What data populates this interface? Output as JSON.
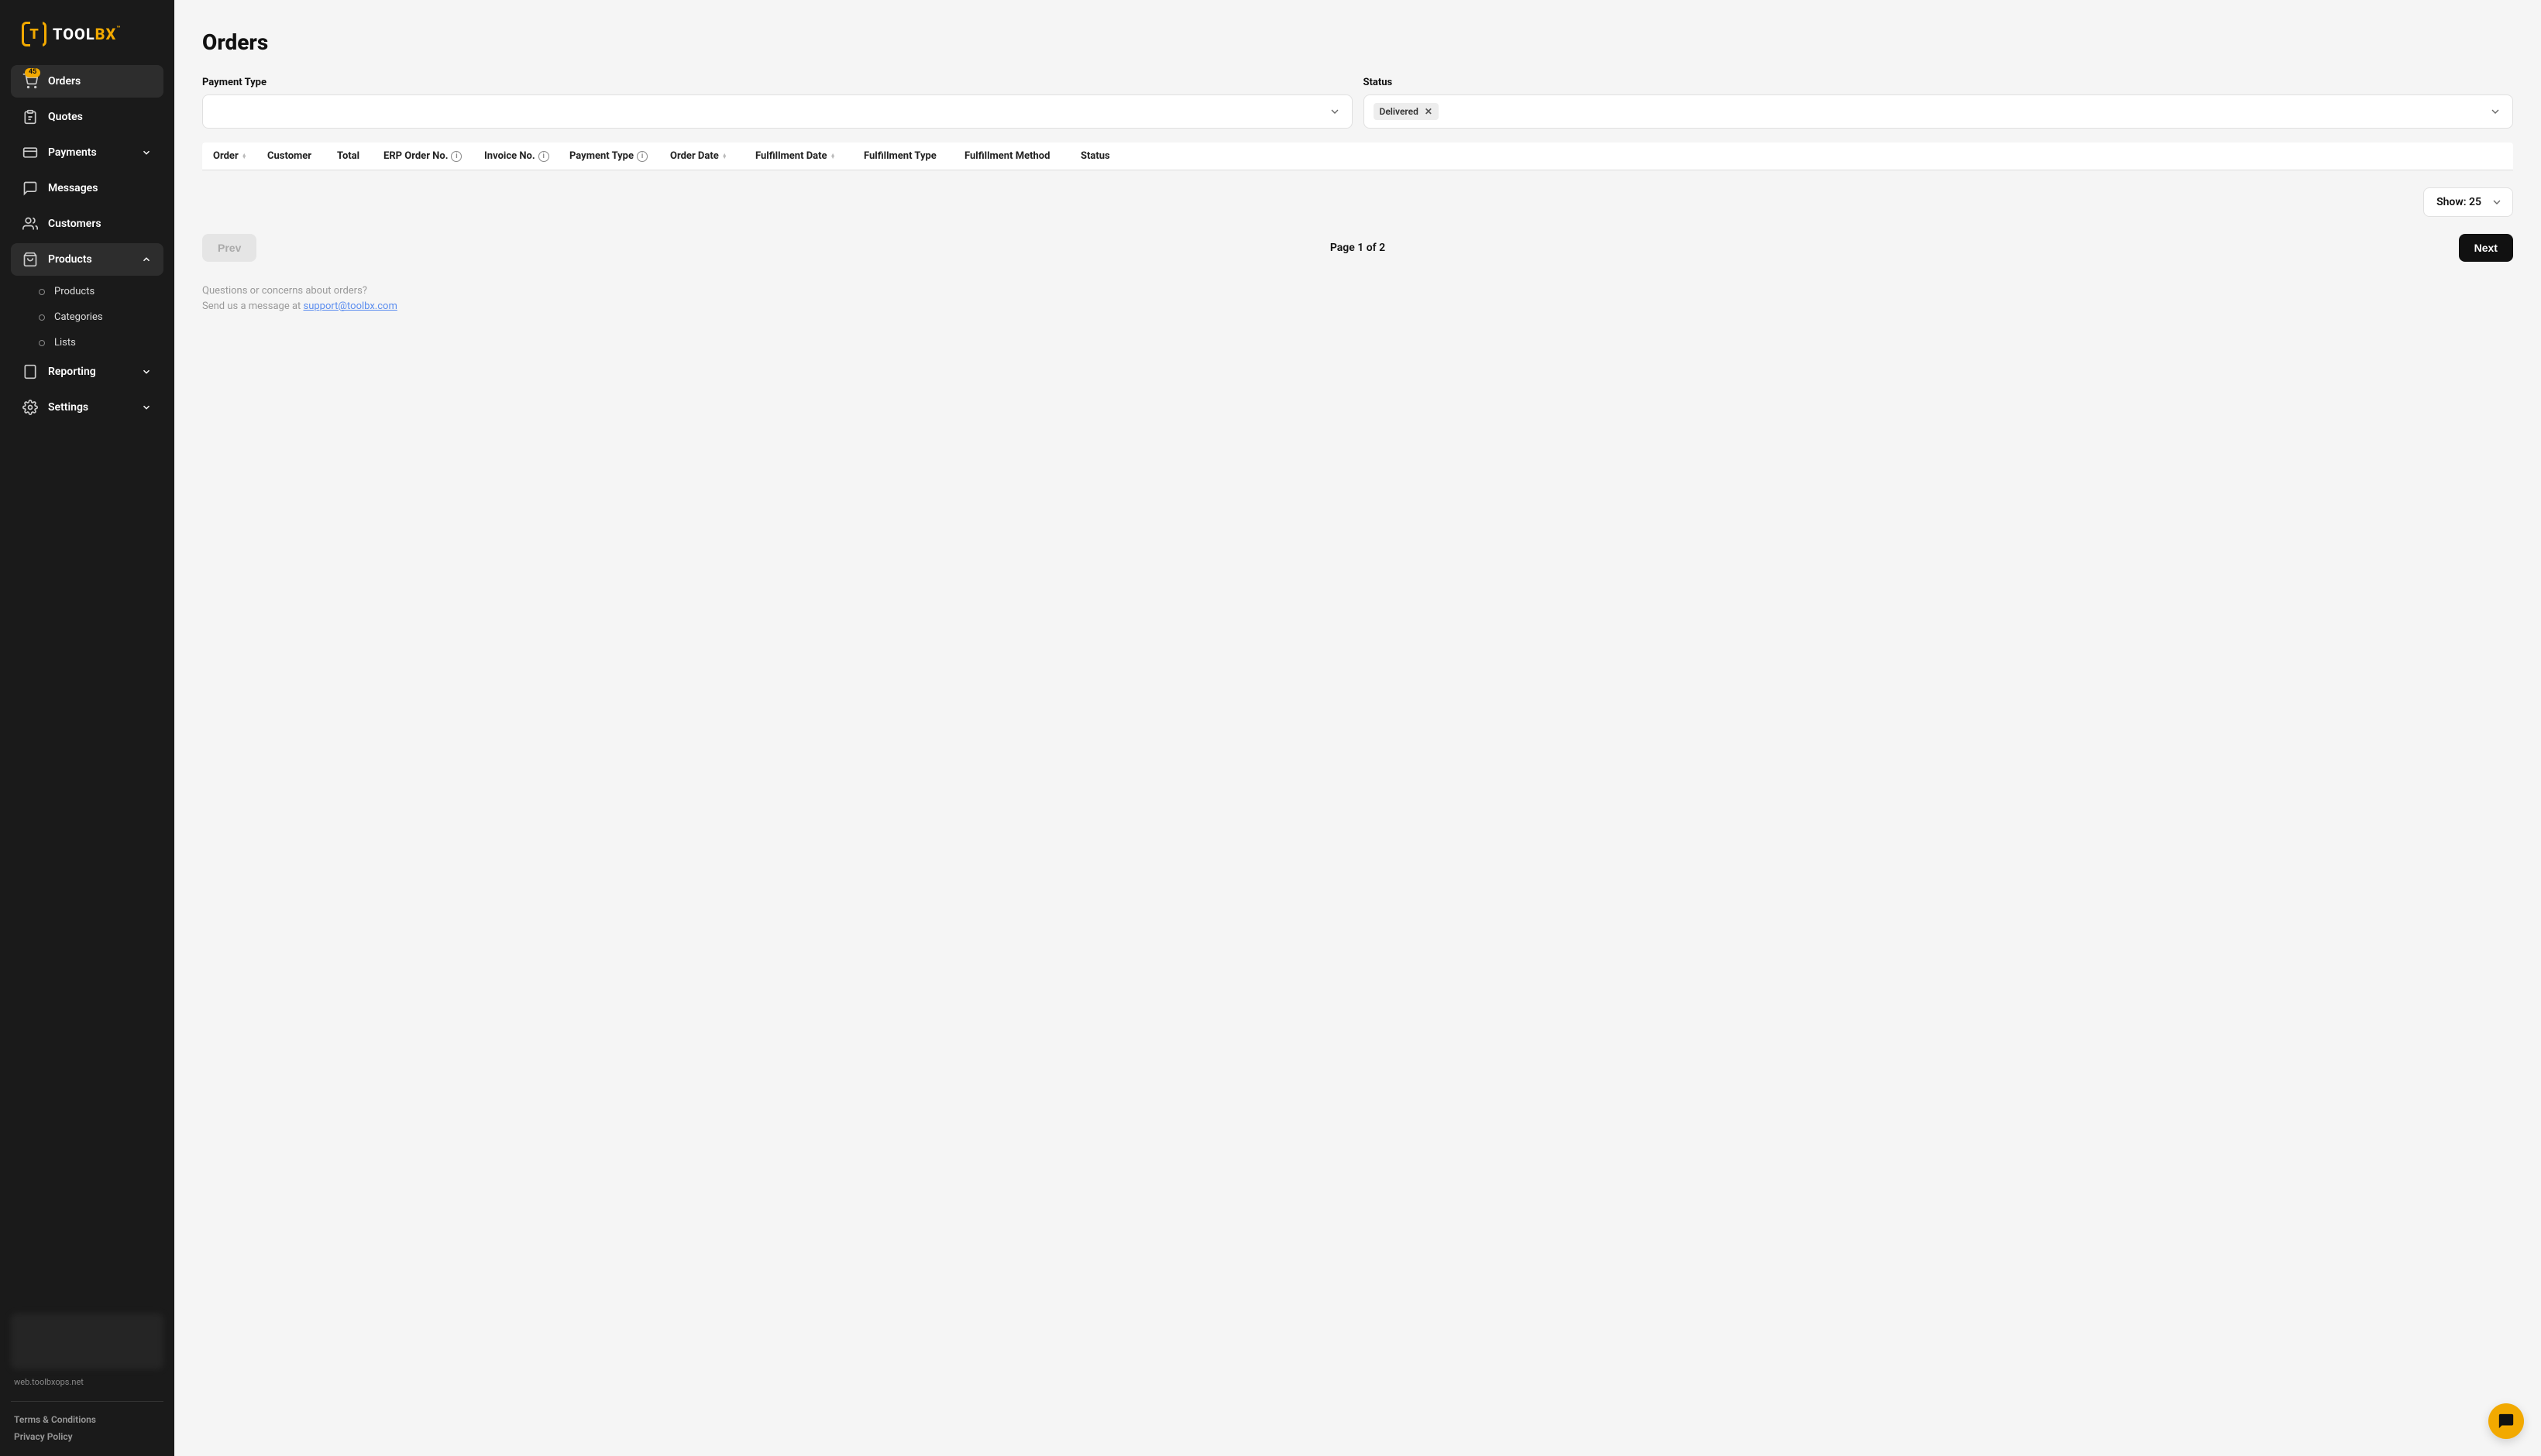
{
  "brand": {
    "name_a": "TOOL",
    "name_b": "BX"
  },
  "sidebar": {
    "items": [
      {
        "label": "Orders",
        "icon": "cart-icon",
        "badge": "45",
        "active": true
      },
      {
        "label": "Quotes",
        "icon": "clipboard-icon"
      },
      {
        "label": "Payments",
        "icon": "card-icon",
        "expandable": true,
        "expanded": false
      },
      {
        "label": "Messages",
        "icon": "chat-icon"
      },
      {
        "label": "Customers",
        "icon": "users-icon"
      },
      {
        "label": "Products",
        "icon": "bag-icon",
        "expandable": true,
        "expanded": true,
        "children": [
          {
            "label": "Products"
          },
          {
            "label": "Categories"
          },
          {
            "label": "Lists"
          }
        ]
      },
      {
        "label": "Reporting",
        "icon": "tablet-icon",
        "expandable": true,
        "expanded": false
      },
      {
        "label": "Settings",
        "icon": "gear-icon",
        "expandable": true,
        "expanded": false
      }
    ],
    "footer_url": "web.toolbxops.net",
    "terms": "Terms & Conditions",
    "privacy": "Privacy Policy"
  },
  "page": {
    "title": "Orders",
    "filters": {
      "payment_type": {
        "label": "Payment Type",
        "value": ""
      },
      "status": {
        "label": "Status",
        "chips": [
          "Delivered"
        ]
      }
    },
    "columns": [
      {
        "label": "Order",
        "sortable": true
      },
      {
        "label": "Customer"
      },
      {
        "label": "Total"
      },
      {
        "label": "ERP Order No.",
        "info": true
      },
      {
        "label": "Invoice No.",
        "info": true
      },
      {
        "label": "Payment Type",
        "info": true
      },
      {
        "label": "Order Date",
        "sortable": true
      },
      {
        "label": "Fulfillment Date",
        "sortable": true
      },
      {
        "label": "Fulfillment Type"
      },
      {
        "label": "Fulfillment Method"
      },
      {
        "label": "Status"
      }
    ],
    "page_size_label": "Show: 25",
    "pagination": {
      "prev": "Prev",
      "next": "Next",
      "info": "Page 1 of 2",
      "prev_disabled": true
    },
    "footnote_q": "Questions or concerns about orders?",
    "footnote_s": "Send us a message at ",
    "footnote_email": "support@toolbx.com"
  }
}
